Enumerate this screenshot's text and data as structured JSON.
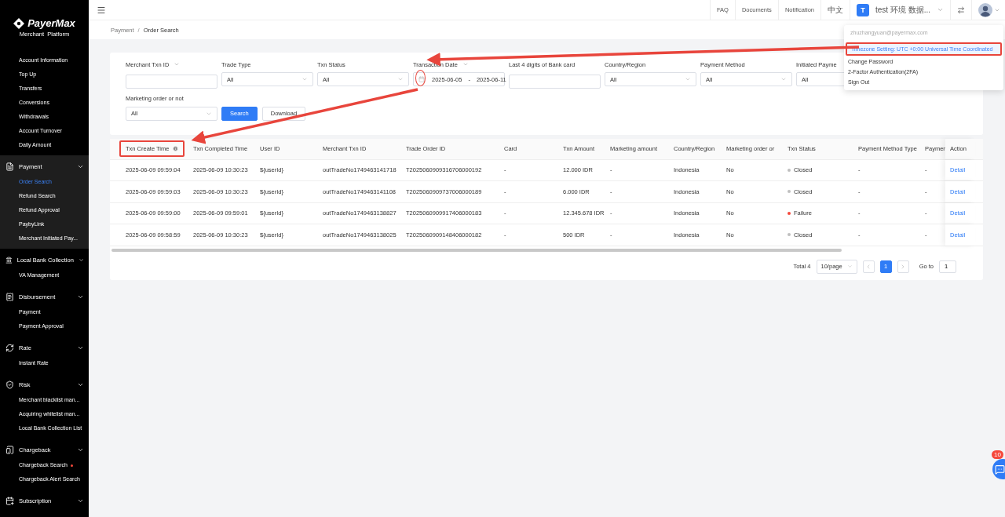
{
  "sidebar": {
    "brand": "PayerMax",
    "subtitle": "Merchant  Platform",
    "items": [
      {
        "label": "Account Information",
        "selected": false
      },
      {
        "label": "Top Up",
        "selected": false
      },
      {
        "label": "Transfers",
        "selected": false
      },
      {
        "label": "Conversions",
        "selected": false
      },
      {
        "label": "Withdrawals",
        "selected": false
      },
      {
        "label": "Account Turnover",
        "selected": false
      },
      {
        "label": "Daily Amount",
        "selected": false
      }
    ],
    "groups": [
      {
        "title": "Payment",
        "active": true,
        "expanded": true,
        "children": [
          {
            "label": "Order Search",
            "selected": true,
            "dot": false
          },
          {
            "label": "Refund Search",
            "selected": false,
            "dot": false
          },
          {
            "label": "Refund Approval",
            "selected": false,
            "dot": false
          },
          {
            "label": "PaybyLink",
            "selected": false,
            "dot": false
          },
          {
            "label": "Merchant Initiated Pay...",
            "selected": false,
            "dot": false
          }
        ]
      },
      {
        "title": "Local Bank Collection",
        "active": false,
        "expanded": true,
        "children": [
          {
            "label": "VA Management",
            "selected": false,
            "dot": false
          }
        ]
      },
      {
        "title": "Disbursement",
        "active": false,
        "expanded": true,
        "children": [
          {
            "label": "Payment",
            "selected": false,
            "dot": false
          },
          {
            "label": "Payment Approval",
            "selected": false,
            "dot": false
          }
        ]
      },
      {
        "title": "Rate",
        "active": false,
        "expanded": true,
        "children": [
          {
            "label": "Instant Rate",
            "selected": false,
            "dot": false
          }
        ]
      },
      {
        "title": "Risk",
        "active": false,
        "expanded": true,
        "children": [
          {
            "label": "Merchant blacklist man...",
            "selected": false,
            "dot": false
          },
          {
            "label": "Acquiring whitelist man...",
            "selected": false,
            "dot": false
          },
          {
            "label": "Local Bank Collection List",
            "selected": false,
            "dot": false
          }
        ]
      },
      {
        "title": "Chargeback",
        "active": false,
        "expanded": true,
        "children": [
          {
            "label": "Chargeback Search",
            "selected": false,
            "dot": true
          },
          {
            "label": "Chargeback Alert Search",
            "selected": false,
            "dot": false
          }
        ]
      },
      {
        "title": "Subscription",
        "active": false,
        "expanded": true
      }
    ]
  },
  "topbar": {
    "links": [
      "FAQ",
      "Documents",
      "Notification",
      "中文"
    ],
    "account": {
      "initial": "T",
      "name": "test 环境 数据..."
    }
  },
  "breadcrumb": [
    "Payment",
    "Order Search"
  ],
  "breadcrumb_separator": "/",
  "filters": [
    {
      "kind": "input",
      "label": "Merchant Txn ID",
      "label_menu": true
    },
    {
      "kind": "select",
      "label": "Trade Type",
      "value": "All",
      "label_menu": false
    },
    {
      "kind": "select",
      "label": "Txn Status",
      "value": "All",
      "label_menu": false
    },
    {
      "kind": "date",
      "label": "Transaction Date",
      "start": "2025-06-05",
      "separator": "-",
      "end": "2025-06-11",
      "label_menu": true
    },
    {
      "kind": "input",
      "label": "Last 4 digits of Bank card",
      "label_menu": false
    },
    {
      "kind": "select",
      "label": "Country/Region",
      "value": "All",
      "label_menu": false
    },
    {
      "kind": "select",
      "label": "Payment Method",
      "value": "All",
      "label_menu": false
    },
    {
      "kind": "select",
      "label": "Initiated Payme",
      "value": "All",
      "label_menu": false
    },
    {
      "kind": "select",
      "label": "Marketing order or not",
      "value": "All",
      "label_menu": false
    }
  ],
  "filter_buttons": [
    {
      "label": "Search",
      "primary": true
    },
    {
      "label": "Download",
      "primary": false
    }
  ],
  "table": {
    "columns": [
      {
        "label": "Txn Create Time",
        "info": true,
        "highlighted": true
      },
      {
        "label": "Txn Completed Time",
        "info": false,
        "highlighted": false
      },
      {
        "label": "User ID",
        "info": false,
        "highlighted": false
      },
      {
        "label": "Merchant Txn ID",
        "info": false,
        "highlighted": false
      },
      {
        "label": "Trade Order ID",
        "info": false,
        "highlighted": false
      },
      {
        "label": "Card",
        "info": false,
        "highlighted": false
      },
      {
        "label": "Txn Amount",
        "info": false,
        "highlighted": false
      },
      {
        "label": "Marketing amount",
        "info": false,
        "highlighted": false
      },
      {
        "label": "Country/Region",
        "info": false,
        "highlighted": false
      },
      {
        "label": "Marketing order or",
        "info": false,
        "highlighted": false
      },
      {
        "label": "Txn Status",
        "info": false,
        "highlighted": false
      },
      {
        "label": "Payment Method Type",
        "info": false,
        "highlighted": false
      },
      {
        "label": "Paymen",
        "info": false,
        "highlighted": false
      },
      {
        "label": "Action",
        "info": false,
        "highlighted": false
      }
    ],
    "rows": [
      {
        "cells": [
          "2025-06-09 09:59:04",
          "2025-06-09 10:30:23",
          "${userId}",
          "outTradeNo1749463141718",
          "T2025060909316706000192",
          "-",
          "12.000 IDR",
          "-",
          "Indonesia",
          "No"
        ],
        "status": {
          "label": "Closed",
          "color": "#bfbfbf"
        },
        "tail": [
          "-",
          "-"
        ],
        "action": "Detail"
      },
      {
        "cells": [
          "2025-06-09 09:59:03",
          "2025-06-09 10:30:23",
          "${userId}",
          "outTradeNo1749463141108",
          "T2025060909737006000189",
          "-",
          "6.000 IDR",
          "-",
          "Indonesia",
          "No"
        ],
        "status": {
          "label": "Closed",
          "color": "#bfbfbf"
        },
        "tail": [
          "-",
          "-"
        ],
        "action": "Detail"
      },
      {
        "cells": [
          "2025-06-09 09:59:00",
          "2025-06-09 09:59:01",
          "${userId}",
          "outTradeNo1749463138827",
          "T2025060909917406000183",
          "-",
          "12.345.678 IDR",
          "-",
          "Indonesia",
          "No"
        ],
        "status": {
          "label": "Failure",
          "color": "#f5483b"
        },
        "tail": [
          "-",
          "-"
        ],
        "action": "Detail"
      },
      {
        "cells": [
          "2025-06-09 09:58:59",
          "2025-06-09 10:30:23",
          "${userId}",
          "outTradeNo1749463138025",
          "T2025060909148406000182",
          "-",
          "500 IDR",
          "-",
          "Indonesia",
          "No"
        ],
        "status": {
          "label": "Closed",
          "color": "#bfbfbf"
        },
        "tail": [
          "-",
          "-"
        ],
        "action": "Detail"
      }
    ]
  },
  "pagination": {
    "total": "Total 4",
    "page_size": "10/page",
    "pages": [
      {
        "label": "1",
        "selected": true
      }
    ],
    "goto_label": "Go to",
    "goto_value": "1"
  },
  "user_menu": {
    "email": "zhuzhangyuan@payermax.com",
    "items": [
      {
        "label": "Timezone Setting: UTC +0:00 Universal Time Coordinated",
        "selected": true,
        "highlighted": true
      },
      {
        "label": "Change Password",
        "selected": false,
        "highlighted": false
      },
      {
        "label": "2-Factor Authentication(2FA)",
        "selected": false,
        "highlighted": false
      },
      {
        "label": "Sign Out",
        "selected": false,
        "highlighted": false
      }
    ]
  },
  "chat": {
    "badge": "10"
  }
}
